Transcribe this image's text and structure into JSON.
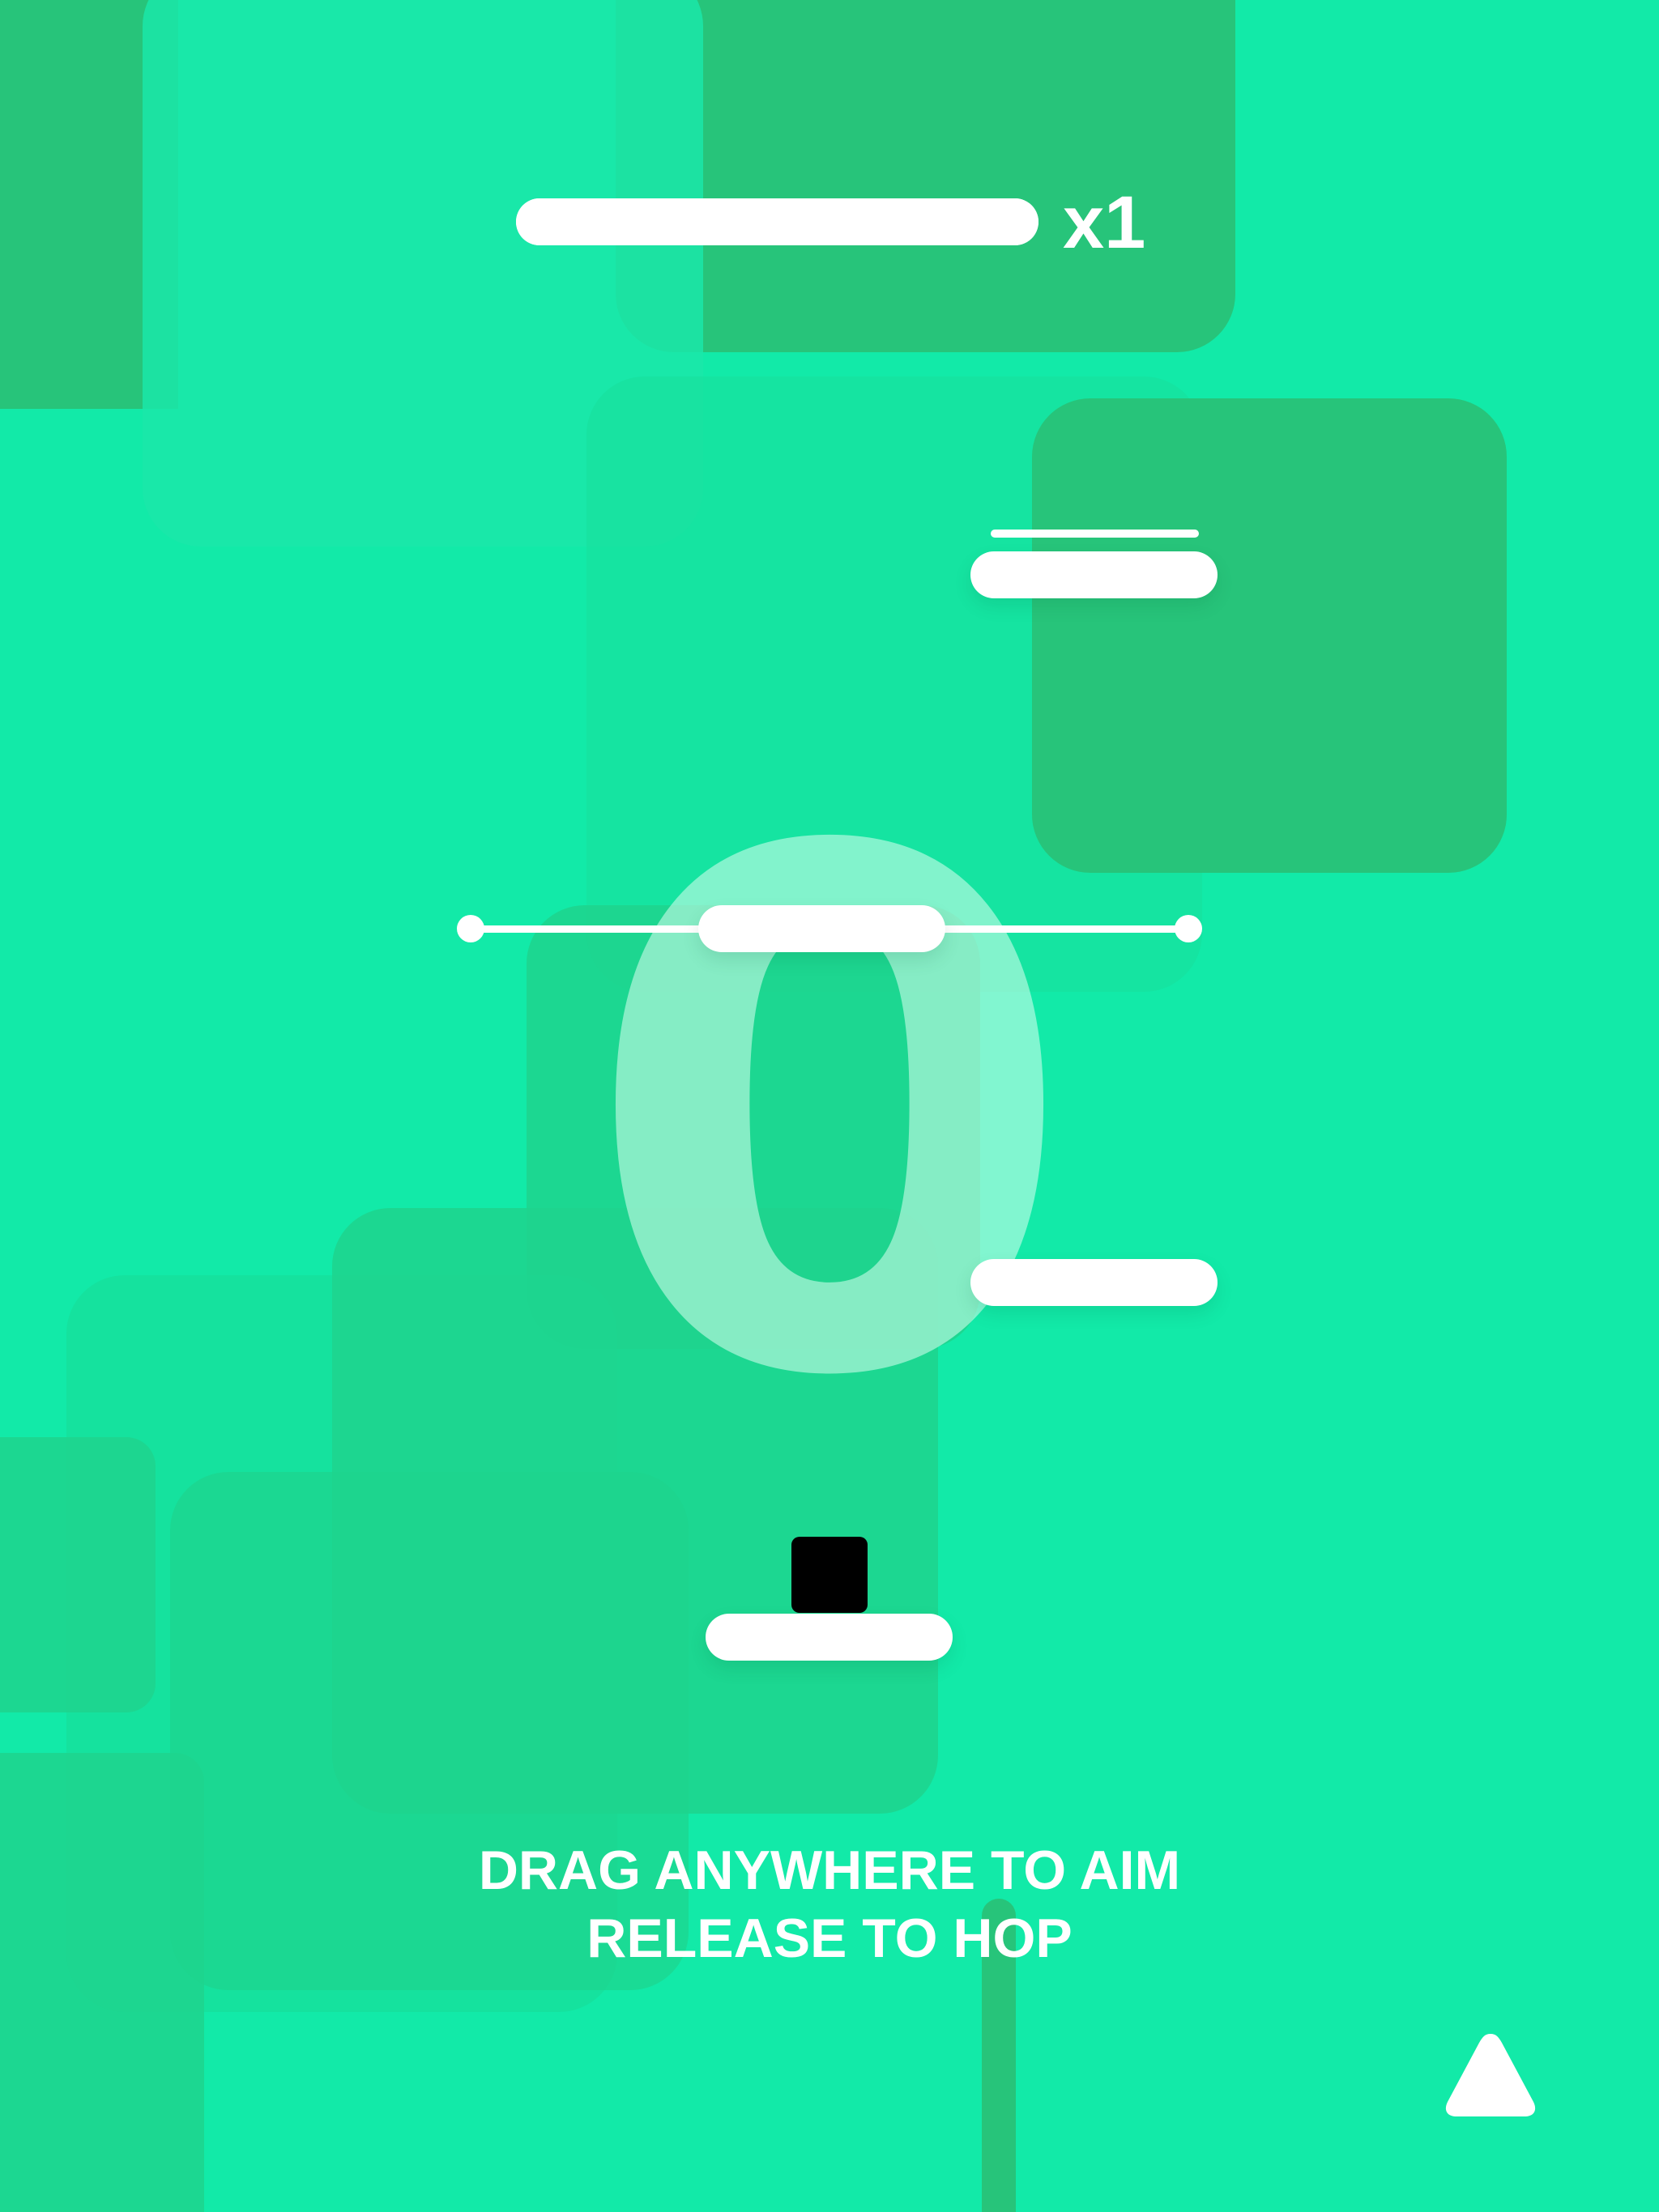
{
  "hud": {
    "progress": 1.0,
    "multiplier": "x1"
  },
  "score": {
    "value": "0"
  },
  "instructions": {
    "line1": "DRAG ANYWHERE TO AIM",
    "line2": "RELEASE TO HOP"
  },
  "controls": {
    "up_button_icon": "triangle-up-icon"
  },
  "colors": {
    "background": "#12EAA8",
    "block_dark": "#27C47A",
    "platform": "#FFFFFF",
    "player": "#000000"
  }
}
